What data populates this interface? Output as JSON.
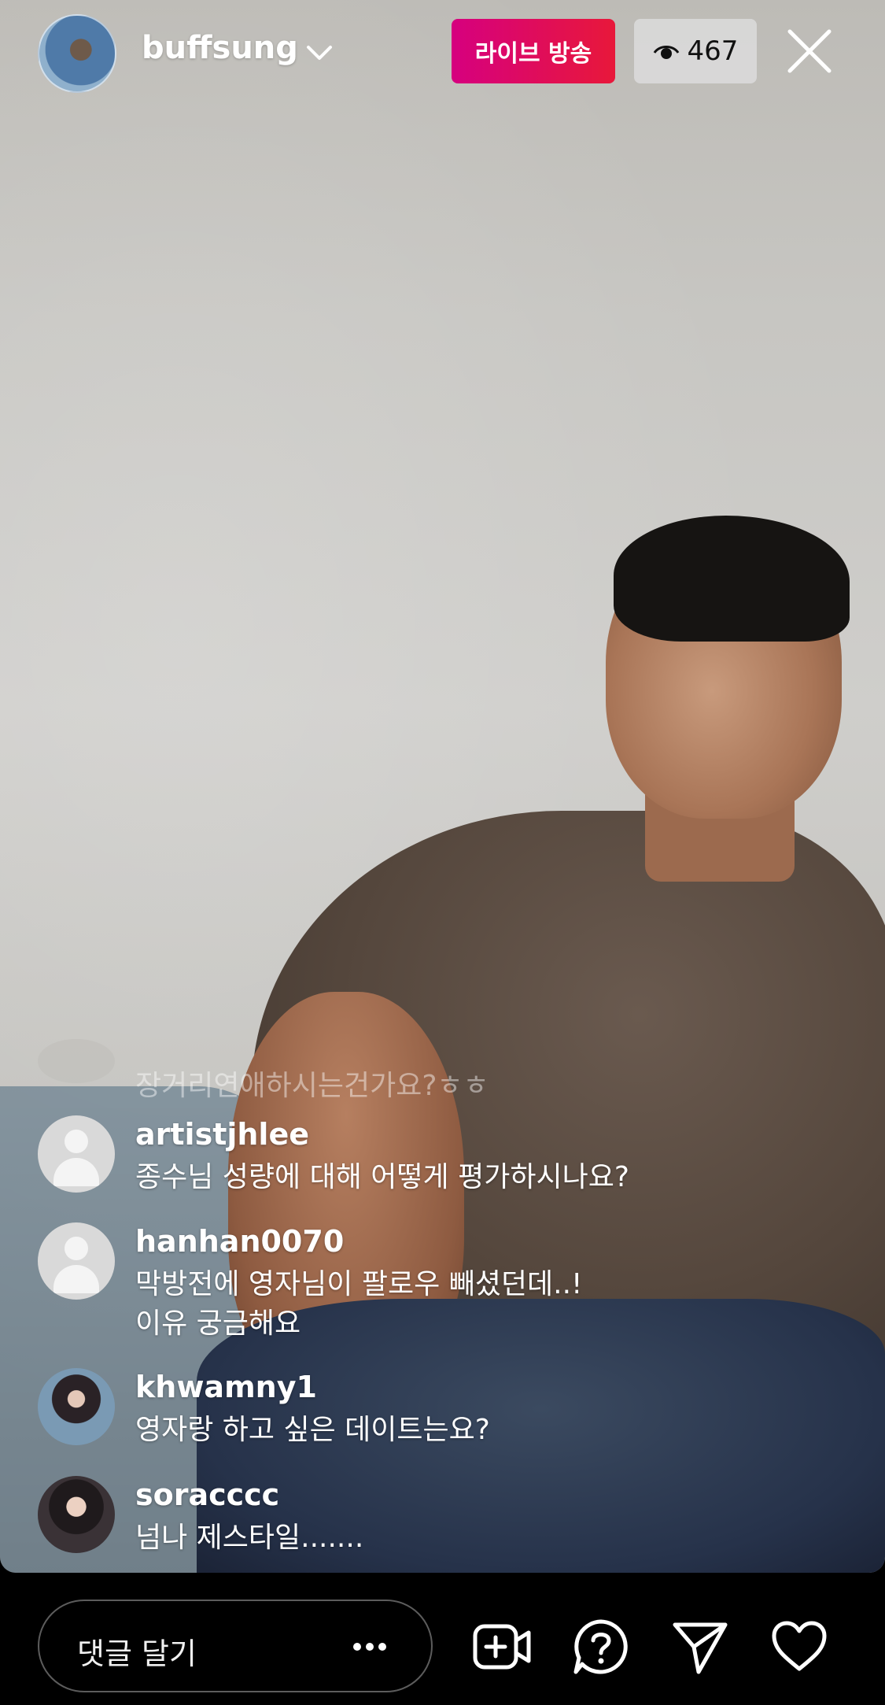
{
  "header": {
    "username": "buffsung",
    "live_label": "라이브 방송",
    "viewer_count": "467"
  },
  "comments": [
    {
      "username": "",
      "text": "장거리연애하시는건가요?ㅎㅎ",
      "faded": true
    },
    {
      "username": "artistjhlee",
      "text": "종수님 성량에 대해 어떻게 평가하시나요?"
    },
    {
      "username": "hanhan0070",
      "text_line1": "막방전에 영자님이 팔로우 빼셨던데..!",
      "text_line2": "이유 궁금해요"
    },
    {
      "username": "khwamny1",
      "text": "영자랑 하고 싶은 데이트는요?"
    },
    {
      "username": "soracccc",
      "text": "넘나 제스타일......."
    }
  ],
  "footer": {
    "comment_placeholder": "댓글 달기"
  },
  "icons": {
    "badge_eye": "eye-icon",
    "close": "close-icon",
    "more": "more-icon",
    "add_video": "add-video-icon",
    "question": "question-icon",
    "share": "send-icon",
    "like": "heart-icon"
  },
  "colors": {
    "live_badge_start": "#d6007f",
    "live_badge_end": "#e8183a"
  }
}
